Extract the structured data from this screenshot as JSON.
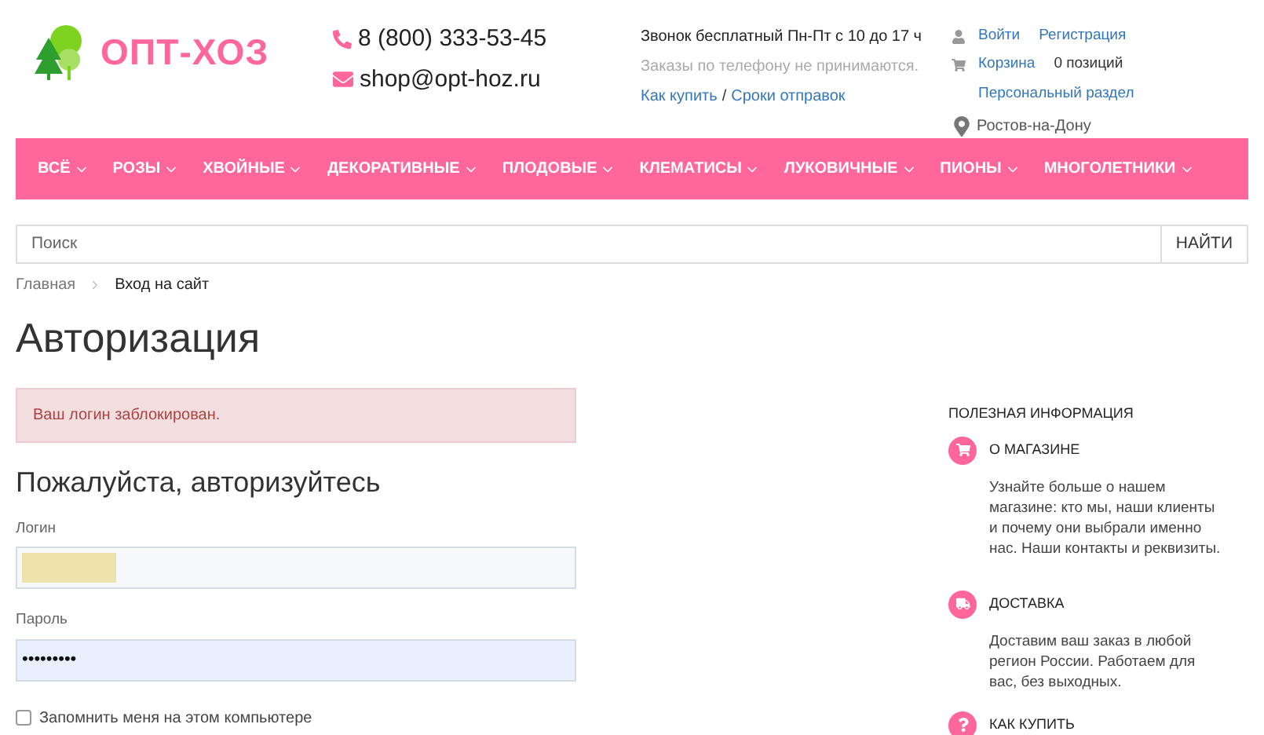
{
  "logo": {
    "text": "ОПТ-ХОЗ"
  },
  "contacts": {
    "phone": "8 (800) 333-53-45",
    "email": "shop@opt-hoz.ru"
  },
  "info": {
    "hours": "Звонок бесплатный Пн-Пт с 10 до 17 ч",
    "note": "Заказы по телефону не принимаются.",
    "link_how": "Как купить",
    "separator": "/",
    "link_shipping": "Сроки отправок"
  },
  "account": {
    "login": "Войти",
    "register": "Регистрация",
    "cart": "Корзина",
    "cart_count": "0 позиций",
    "personal": "Персональный раздел",
    "city": "Ростов-на-Дону"
  },
  "nav": [
    {
      "label": "ВСЁ"
    },
    {
      "label": "РОЗЫ"
    },
    {
      "label": "ХВОЙНЫЕ"
    },
    {
      "label": "ДЕКОРАТИВНЫЕ"
    },
    {
      "label": "ПЛОДОВЫЕ"
    },
    {
      "label": "КЛЕМАТИСЫ"
    },
    {
      "label": "ЛУКОВИЧНЫЕ"
    },
    {
      "label": "ПИОНЫ"
    },
    {
      "label": "МНОГОЛЕТНИКИ"
    }
  ],
  "search": {
    "placeholder": "Поиск",
    "button": "НАЙТИ"
  },
  "breadcrumb": [
    {
      "label": "Главная",
      "current": false
    },
    {
      "label": "Вход на сайт",
      "current": true
    }
  ],
  "page_title": "Авторизация",
  "alert": "Ваш логин заблокирован.",
  "form": {
    "subtitle": "Пожалуйста, авторизуйтесь",
    "login_label": "Логин",
    "login_autofilled": true,
    "password_label": "Пароль",
    "password_value": "•••••••••",
    "remember": {
      "label": "Запомнить меня на этом компьютере",
      "checked": false
    }
  },
  "sidebar": {
    "title": "ПОЛЕЗНАЯ ИНФОРМАЦИЯ",
    "items": [
      {
        "kind": "cart",
        "title": "О МАГАЗИНЕ",
        "text": "Узнайте больше о нашем магазине: кто мы, наши клиенты и почему они выбрали именно нас. Наши контакты и реквизиты."
      },
      {
        "kind": "truck",
        "title": "ДОСТАВКА",
        "text": "Доставим ваш заказ в любой регион России. Работаем для вас, без выходных."
      },
      {
        "kind": "question",
        "title": "КАК КУПИТЬ"
      }
    ]
  }
}
